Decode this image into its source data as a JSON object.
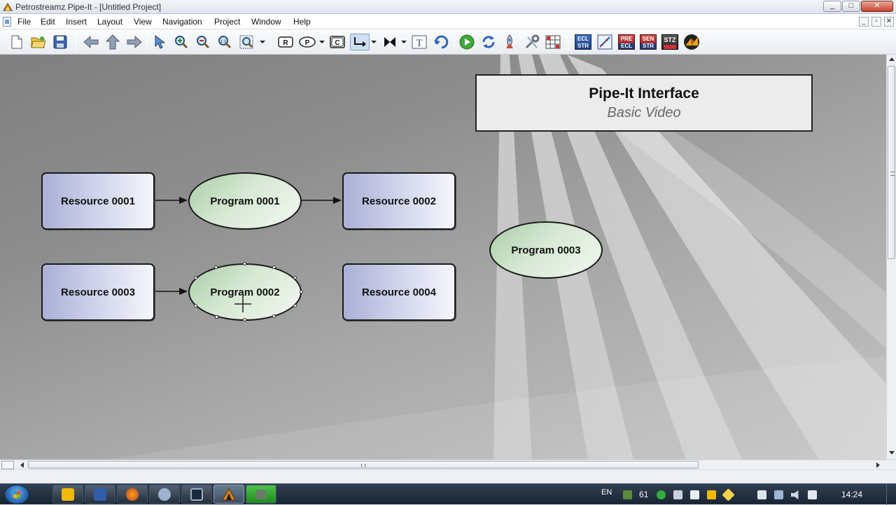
{
  "window": {
    "title": "Petrostreamz Pipe-It - [Untitled Project]",
    "buttons": [
      "_",
      "□",
      "✕"
    ],
    "mdi_buttons": [
      "_",
      "▫",
      "✕"
    ]
  },
  "menu": {
    "items": [
      "File",
      "Edit",
      "Insert",
      "Layout",
      "View",
      "Navigation",
      "Project",
      "Window",
      "Help"
    ]
  },
  "toolbar": {
    "tools": [
      {
        "name": "new-icon"
      },
      {
        "name": "open-icon"
      },
      {
        "name": "save-icon"
      },
      {
        "name": "back-arrow-icon"
      },
      {
        "name": "up-arrow-icon"
      },
      {
        "name": "forward-arrow-icon"
      },
      {
        "name": "select-pointer-icon"
      },
      {
        "name": "zoom-in-icon"
      },
      {
        "name": "zoom-out-icon"
      },
      {
        "name": "zoom-100-icon"
      },
      {
        "name": "zoom-fit-icon"
      },
      {
        "name": "resource-tool",
        "label": "R"
      },
      {
        "name": "program-tool",
        "label": "P"
      },
      {
        "name": "composite-tool",
        "label": "C"
      },
      {
        "name": "connector-tool"
      },
      {
        "name": "bowtie-icon"
      },
      {
        "name": "text-tool",
        "label": "T"
      },
      {
        "name": "undo-icon"
      },
      {
        "name": "run-icon"
      },
      {
        "name": "refresh-icon"
      },
      {
        "name": "rocket-icon"
      },
      {
        "name": "wrench-icon"
      },
      {
        "name": "grid-icon"
      }
    ],
    "plugins": [
      {
        "name": "ecl-str-plugin",
        "top": "ECL",
        "bottom": "STR"
      },
      {
        "name": "plot-plugin"
      },
      {
        "name": "pre-ecl-plugin",
        "top": "PRE",
        "bottom": "ECL"
      },
      {
        "name": "sen-str-plugin",
        "top": "SEN",
        "bottom": "STR"
      },
      {
        "name": "stz-plugin",
        "top": "STZ"
      },
      {
        "name": "matlab-plugin"
      }
    ]
  },
  "diagram": {
    "info_box": {
      "title": "Pipe-It Interface",
      "subtitle": "Basic Video"
    },
    "resources": [
      "Resource 0001",
      "Resource 0002",
      "Resource 0003",
      "Resource 0004"
    ],
    "programs": [
      "Program 0001",
      "Program 0002",
      "Program 0003"
    ],
    "selected": "Program 0002"
  },
  "taskbar": {
    "language": "EN",
    "tray_count": "61",
    "clock": "14:24",
    "apps": [
      "outlook-app",
      "save-app",
      "firefox-app",
      "vpn-app",
      "monitor-app",
      "pipe-it-app",
      "green-app"
    ]
  }
}
